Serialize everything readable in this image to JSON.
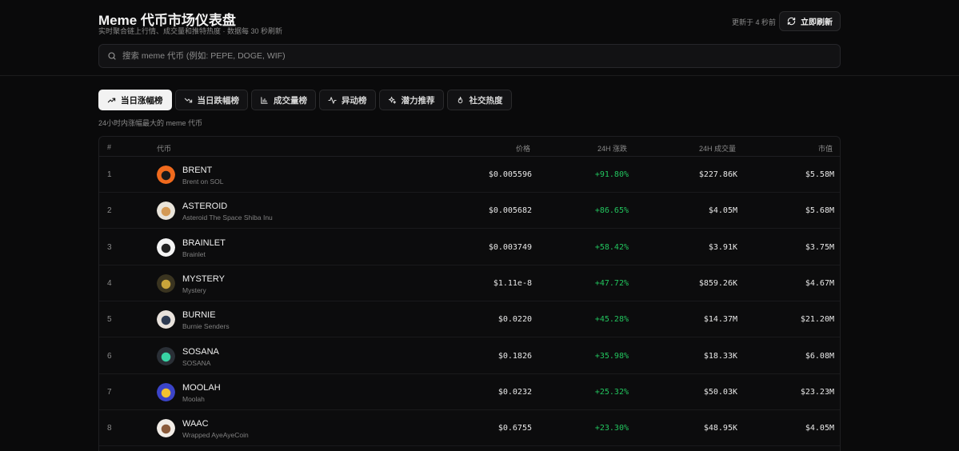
{
  "header": {
    "title": "Meme 代币市场仪表盘",
    "subtitle": "实时聚合链上行情、成交量和推特热度 · 数据每 30 秒刷新",
    "updated": "更新于 4 秒前",
    "refresh_label": "立即刷新"
  },
  "search": {
    "placeholder": "搜索 meme 代币 (例如: PEPE, DOGE, WIF)",
    "value": ""
  },
  "tabs": [
    {
      "label": "当日涨幅榜",
      "icon": "trending-up-icon",
      "active": true
    },
    {
      "label": "当日跌幅榜",
      "icon": "trending-down-icon",
      "active": false
    },
    {
      "label": "成交量榜",
      "icon": "bar-chart-icon",
      "active": false
    },
    {
      "label": "异动榜",
      "icon": "activity-icon",
      "active": false
    },
    {
      "label": "潜力推荐",
      "icon": "sparkles-icon",
      "active": false
    },
    {
      "label": "社交热度",
      "icon": "flame-icon",
      "active": false
    }
  ],
  "caption": "24小时内涨幅最大的 meme 代币",
  "table": {
    "headers": {
      "rank": "#",
      "coin": "代币",
      "price": "价格",
      "change": "24H 涨跌",
      "volume": "24H 成交量",
      "mcap": "市值"
    },
    "rows": [
      {
        "rank": "1",
        "symbol": "BRENT",
        "name": "Brent on SOL",
        "price": "$0.005596",
        "change": "+91.80%",
        "volume": "$227.86K",
        "mcap": "$5.58M",
        "logo_color": "#f06a1d",
        "logo_accent": "#1a1a1a"
      },
      {
        "rank": "2",
        "symbol": "ASTEROID",
        "name": "Asteroid The Space Shiba Inu",
        "price": "$0.005682",
        "change": "+86.65%",
        "volume": "$4.05M",
        "mcap": "$5.68M",
        "logo_color": "#e9e4da",
        "logo_accent": "#d49a55"
      },
      {
        "rank": "3",
        "symbol": "BRAINLET",
        "name": "Brainlet",
        "price": "$0.003749",
        "change": "+58.42%",
        "volume": "$3.91K",
        "mcap": "$3.75M",
        "logo_color": "#f4f4f4",
        "logo_accent": "#222222"
      },
      {
        "rank": "4",
        "symbol": "MYSTERY",
        "name": "Mystery",
        "price": "$1.11e-8",
        "change": "+47.72%",
        "volume": "$859.26K",
        "mcap": "$4.67M",
        "logo_color": "#3a3420",
        "logo_accent": "#c9a43a"
      },
      {
        "rank": "5",
        "symbol": "BURNIE",
        "name": "Burnie Senders",
        "price": "$0.0220",
        "change": "+45.28%",
        "volume": "$14.37M",
        "mcap": "$21.20M",
        "logo_color": "#e8e2dc",
        "logo_accent": "#2e3b52"
      },
      {
        "rank": "6",
        "symbol": "SOSANA",
        "name": "SOSANA",
        "price": "$0.1826",
        "change": "+35.98%",
        "volume": "$18.33K",
        "mcap": "$6.08M",
        "logo_color": "#2a2f36",
        "logo_accent": "#38d3a4"
      },
      {
        "rank": "7",
        "symbol": "MOOLAH",
        "name": "Moolah",
        "price": "$0.0232",
        "change": "+25.32%",
        "volume": "$50.03K",
        "mcap": "$23.23M",
        "logo_color": "#3b44c8",
        "logo_accent": "#f2c230"
      },
      {
        "rank": "8",
        "symbol": "WAAC",
        "name": "Wrapped AyeAyeCoin",
        "price": "$0.6755",
        "change": "+23.30%",
        "volume": "$48.95K",
        "mcap": "$4.05M",
        "logo_color": "#f1ece6",
        "logo_accent": "#8a5a3a"
      }
    ]
  },
  "colors": {
    "positive": "#22c55e",
    "background": "#0a0a0b",
    "accent_tab": "#f2f2f2"
  }
}
